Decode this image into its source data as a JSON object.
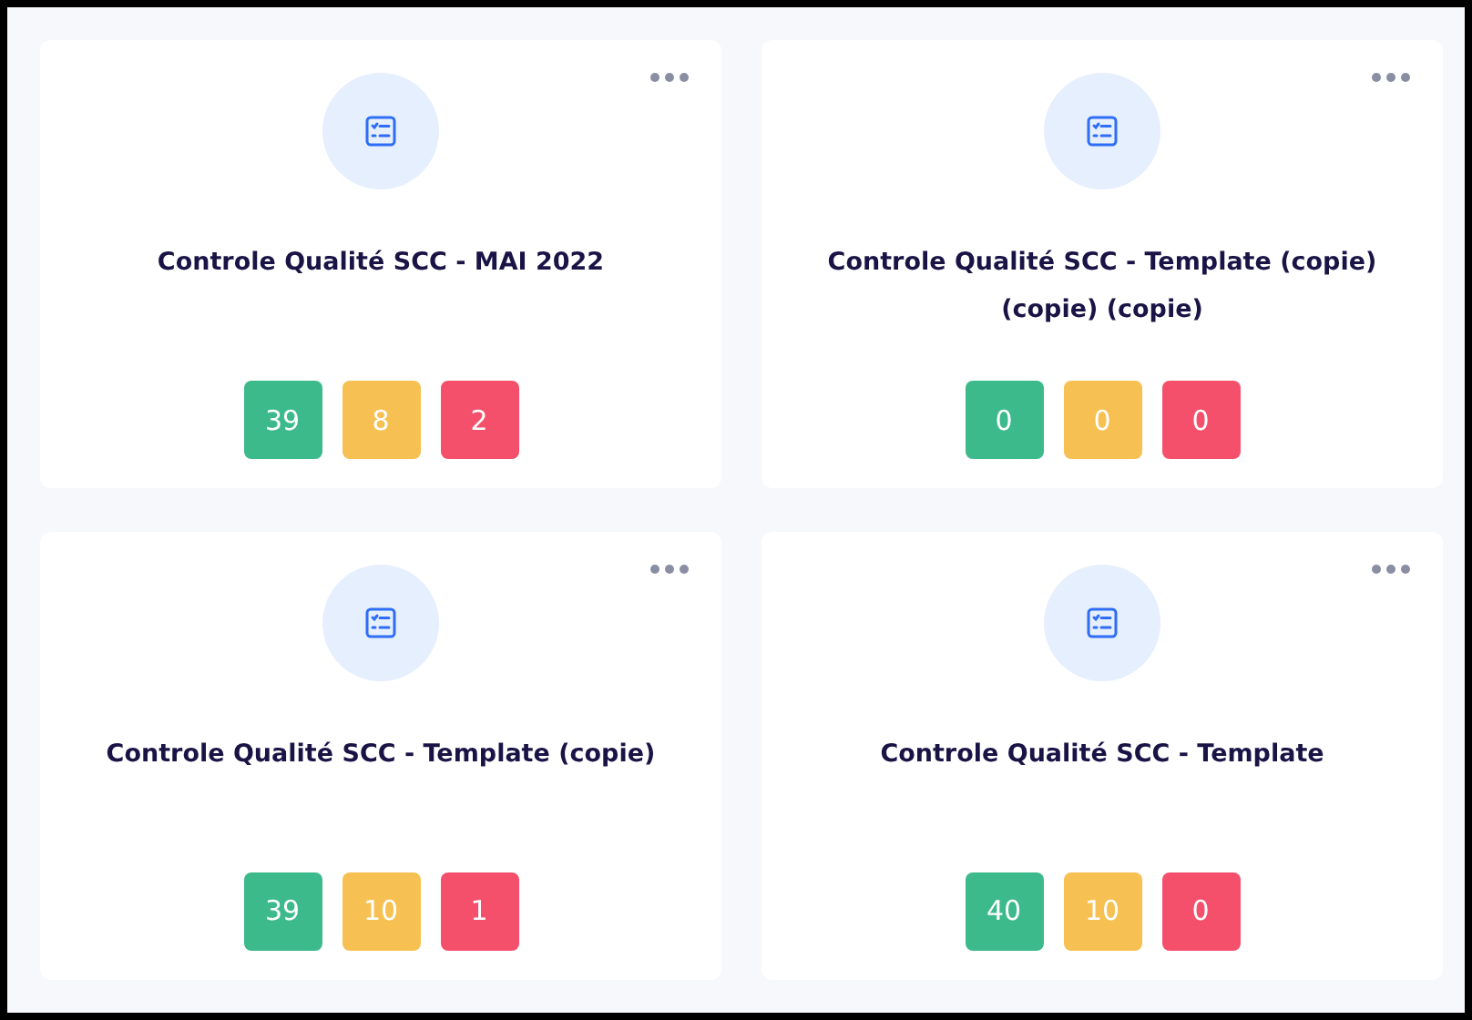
{
  "cards": [
    {
      "title": "Controle Qualité SCC - MAI 2022",
      "counts": [
        {
          "value": "39",
          "color": "#3dba8c"
        },
        {
          "value": "8",
          "color": "#f7c052"
        },
        {
          "value": "2",
          "color": "#f4506c"
        }
      ]
    },
    {
      "title": "Controle Qualité SCC - Template (copie) (copie) (copie)",
      "counts": [
        {
          "value": "0",
          "color": "#3dba8c"
        },
        {
          "value": "0",
          "color": "#f7c052"
        },
        {
          "value": "0",
          "color": "#f4506c"
        }
      ]
    },
    {
      "title": "Controle Qualité SCC - Template (copie)",
      "counts": [
        {
          "value": "39",
          "color": "#3dba8c"
        },
        {
          "value": "10",
          "color": "#f7c052"
        },
        {
          "value": "1",
          "color": "#f4506c"
        }
      ]
    },
    {
      "title": "Controle Qualité SCC - Template",
      "counts": [
        {
          "value": "40",
          "color": "#3dba8c"
        },
        {
          "value": "10",
          "color": "#f7c052"
        },
        {
          "value": "0",
          "color": "#f4506c"
        }
      ]
    }
  ]
}
